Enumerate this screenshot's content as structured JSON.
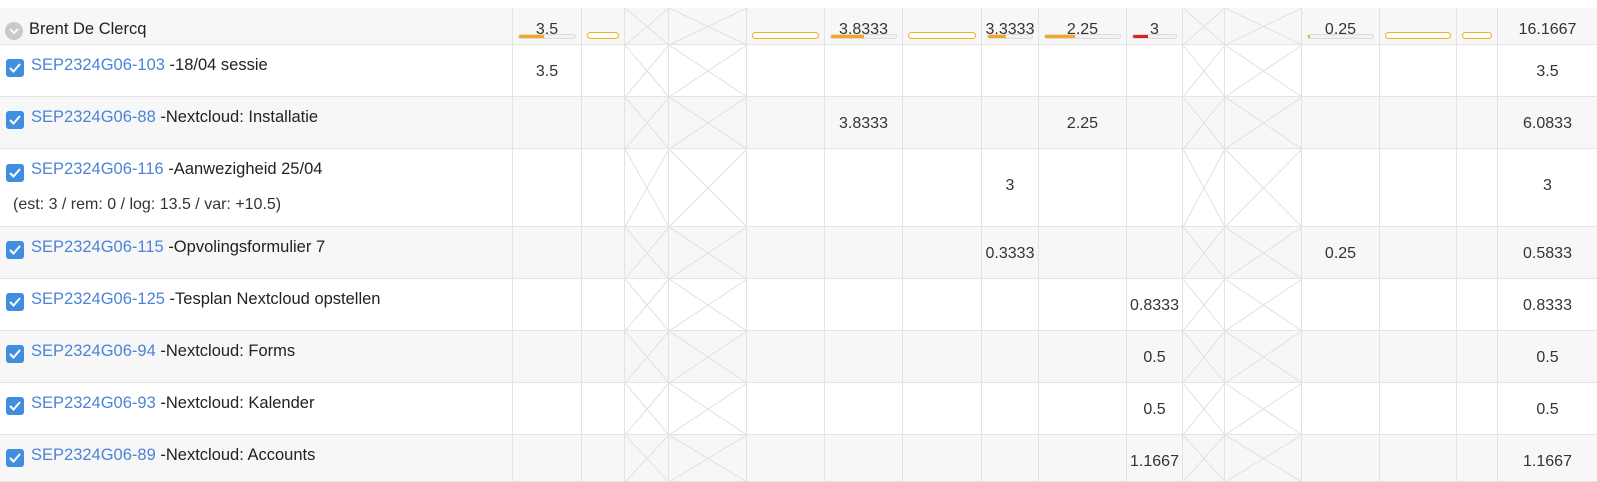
{
  "summary": {
    "user_name": "Brent De Clercq",
    "values": [
      "3.5",
      "",
      "",
      "",
      "",
      "3.8333",
      "",
      "3.3333",
      "2.25",
      "3",
      "",
      "",
      "0.25",
      "",
      "",
      "16.1667"
    ],
    "bars": [
      0.45,
      0,
      null,
      null,
      0,
      0.5,
      0,
      0.4,
      0.4,
      0.35,
      null,
      0,
      0.03,
      0,
      0,
      null
    ],
    "bar_colors": {
      "progress": "#f5a623",
      "over": "#e02020",
      "empty_outline": "#f0b020"
    }
  },
  "rows": [
    {
      "key": "SEP2324G06-103",
      "title": "-18/04 sessie",
      "values": [
        "3.5",
        "",
        "",
        "",
        "",
        "",
        "",
        "",
        "",
        "",
        "",
        "",
        "",
        "",
        "",
        "3.5"
      ]
    },
    {
      "key": "SEP2324G06-88",
      "title": "-Nextcloud: Installatie",
      "values": [
        "",
        "",
        "",
        "",
        "",
        "3.8333",
        "",
        "",
        "2.25",
        "",
        "",
        "",
        "",
        "",
        "",
        "6.0833"
      ]
    },
    {
      "key": "SEP2324G06-116",
      "title": "-Aanwezigheid 25/04",
      "subtitle": "(est: 3 / rem: 0 / log: 13.5 / var: +10.5)",
      "values": [
        "",
        "",
        "",
        "",
        "",
        "",
        "",
        "3",
        "",
        "",
        "",
        "",
        "",
        "",
        "",
        "3"
      ]
    },
    {
      "key": "SEP2324G06-115",
      "title": "-Opvolingsformulier 7",
      "values": [
        "",
        "",
        "",
        "",
        "",
        "",
        "",
        "0.3333",
        "",
        "",
        "",
        "",
        "0.25",
        "",
        "",
        "0.5833"
      ]
    },
    {
      "key": "SEP2324G06-125",
      "title": "-Tesplan Nextcloud opstellen",
      "values": [
        "",
        "",
        "",
        "",
        "",
        "",
        "",
        "",
        "",
        "0.8333",
        "",
        "",
        "",
        "",
        "",
        "0.8333"
      ]
    },
    {
      "key": "SEP2324G06-94",
      "title": "-Nextcloud: Forms",
      "values": [
        "",
        "",
        "",
        "",
        "",
        "",
        "",
        "",
        "",
        "0.5",
        "",
        "",
        "",
        "",
        "",
        "0.5"
      ]
    },
    {
      "key": "SEP2324G06-93",
      "title": "-Nextcloud: Kalender",
      "values": [
        "",
        "",
        "",
        "",
        "",
        "",
        "",
        "",
        "",
        "0.5",
        "",
        "",
        "",
        "",
        "",
        "0.5"
      ]
    },
    {
      "key": "SEP2324G06-89",
      "title": "-Nextcloud: Accounts",
      "values": [
        "",
        "",
        "",
        "",
        "",
        "",
        "",
        "",
        "",
        "1.1667",
        "",
        "",
        "",
        "",
        "",
        "1.1667"
      ]
    }
  ],
  "icons": {
    "expand": "chevron-down-icon",
    "checkbox": "checkbox-checked-icon"
  },
  "colors": {
    "link": "#4a84d6",
    "checkbox": "#3f8ee0",
    "row_alt": "#f7f7f7",
    "grid": "#e2e2e2"
  }
}
